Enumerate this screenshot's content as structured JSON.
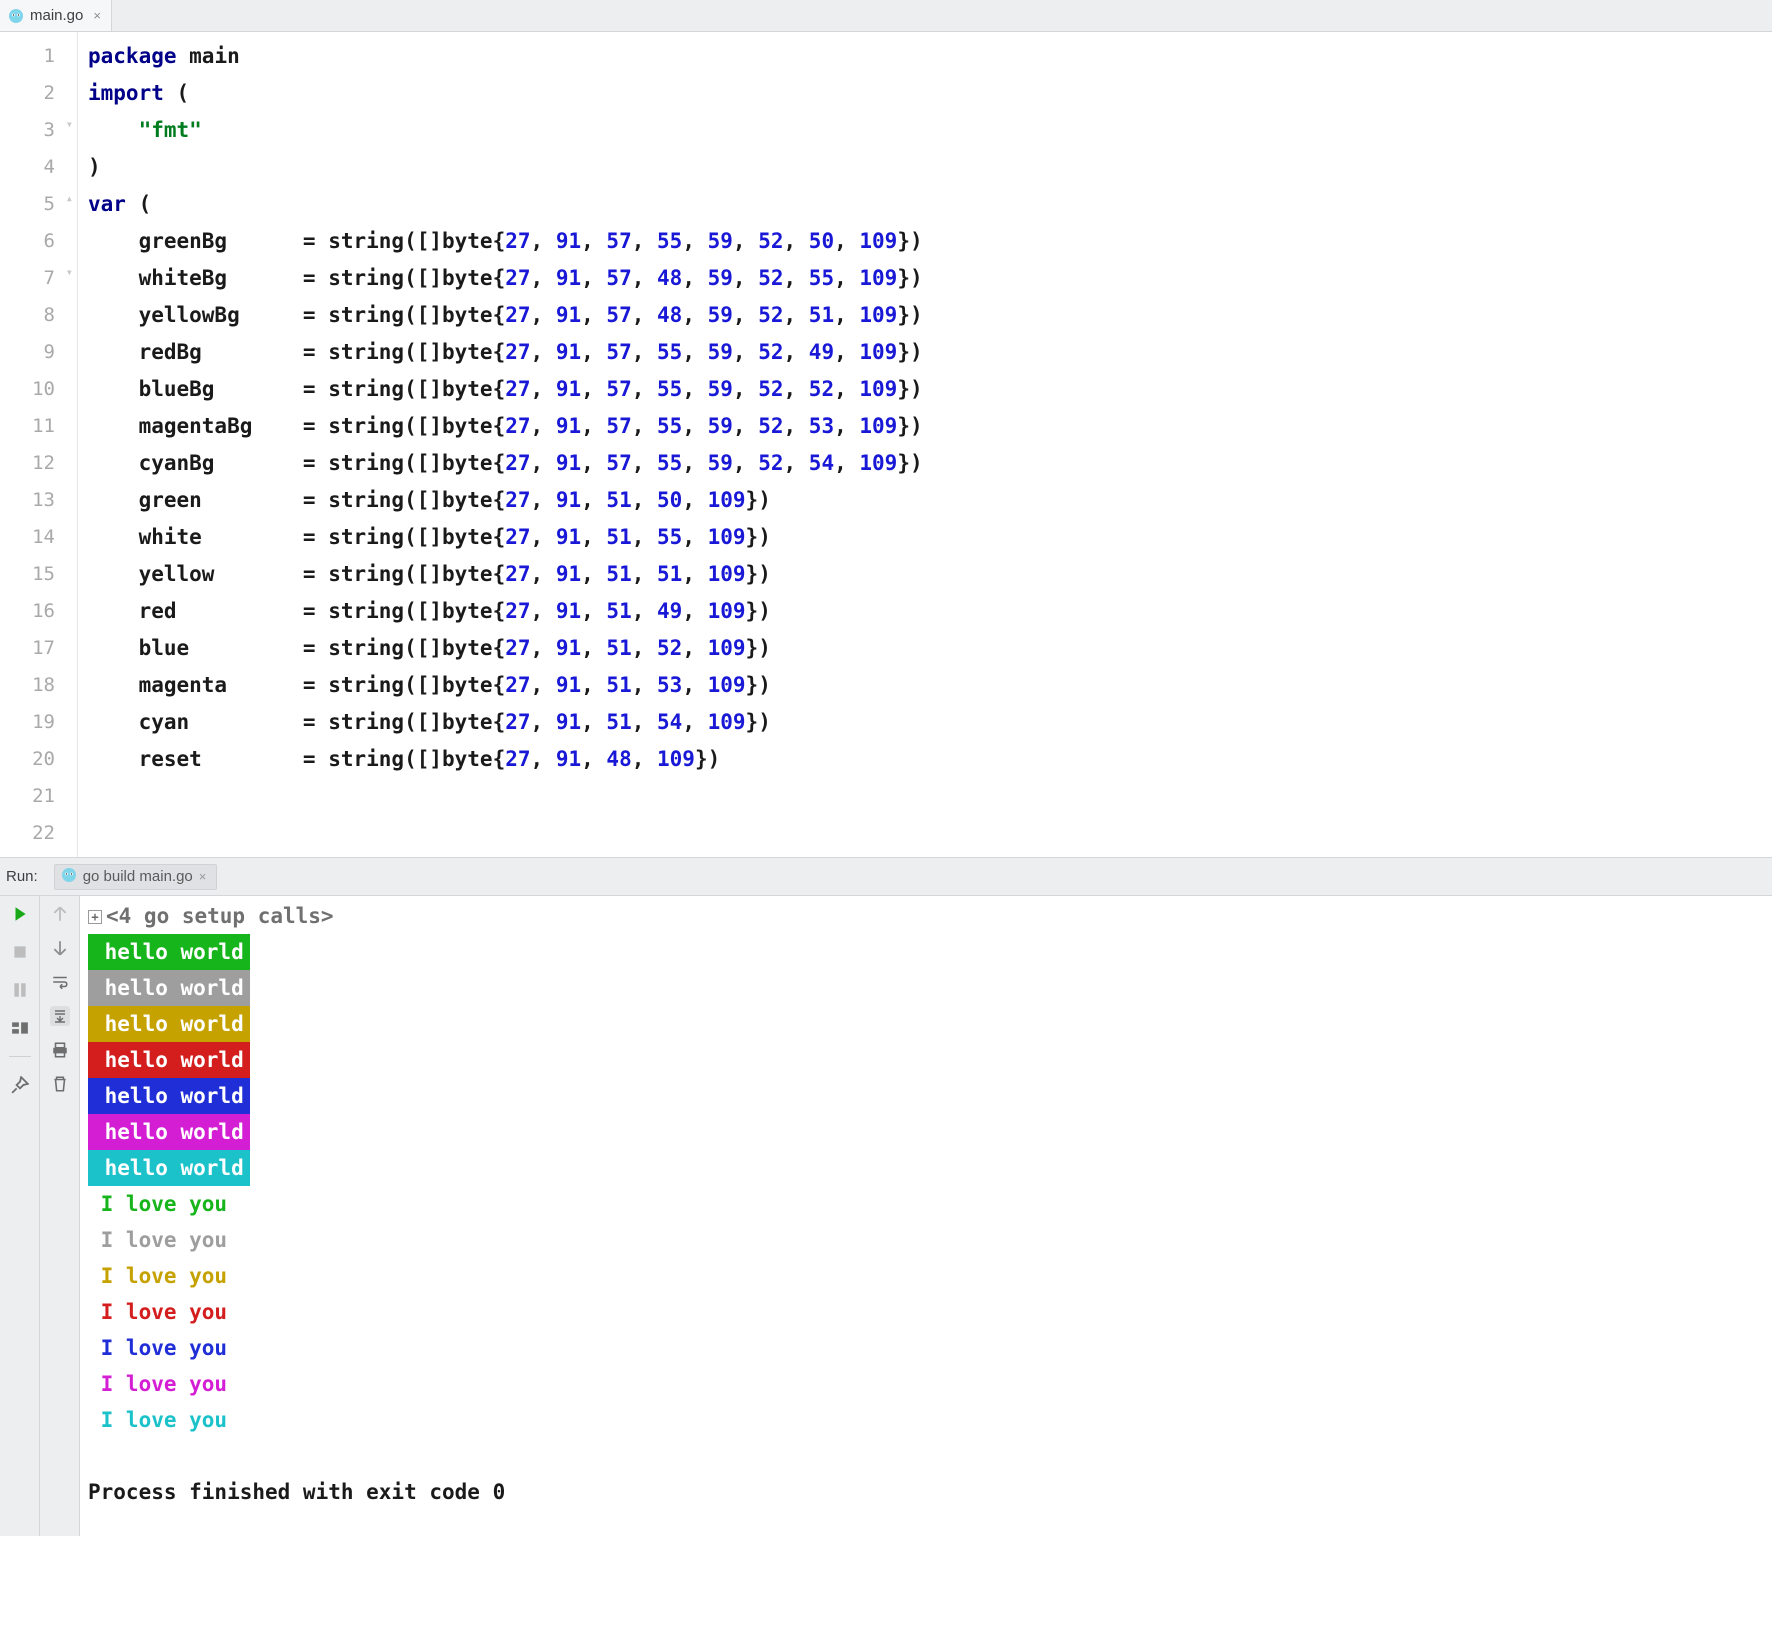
{
  "tab": {
    "filename": "main.go",
    "close_glyph": "×"
  },
  "editor": {
    "line_count": 22,
    "code_pre": "package",
    "code_main": " main",
    "line3_kw": "import",
    "line3_rest": " (",
    "line4_indent": "    ",
    "line4_str": "\"fmt\"",
    "line5": ")",
    "line7_kw": "var",
    "line7_rest": " (",
    "vars": [
      {
        "name": "greenBg",
        "pad": "      ",
        "bytes": [
          27,
          91,
          57,
          55,
          59,
          52,
          50,
          109
        ]
      },
      {
        "name": "whiteBg",
        "pad": "      ",
        "bytes": [
          27,
          91,
          57,
          48,
          59,
          52,
          55,
          109
        ]
      },
      {
        "name": "yellowBg",
        "pad": "     ",
        "bytes": [
          27,
          91,
          57,
          48,
          59,
          52,
          51,
          109
        ]
      },
      {
        "name": "redBg",
        "pad": "        ",
        "bytes": [
          27,
          91,
          57,
          55,
          59,
          52,
          49,
          109
        ]
      },
      {
        "name": "blueBg",
        "pad": "       ",
        "bytes": [
          27,
          91,
          57,
          55,
          59,
          52,
          52,
          109
        ]
      },
      {
        "name": "magentaBg",
        "pad": "    ",
        "bytes": [
          27,
          91,
          57,
          55,
          59,
          52,
          53,
          109
        ]
      },
      {
        "name": "cyanBg",
        "pad": "       ",
        "bytes": [
          27,
          91,
          57,
          55,
          59,
          52,
          54,
          109
        ]
      },
      {
        "name": "green",
        "pad": "        ",
        "bytes": [
          27,
          91,
          51,
          50,
          109
        ]
      },
      {
        "name": "white",
        "pad": "        ",
        "bytes": [
          27,
          91,
          51,
          55,
          109
        ]
      },
      {
        "name": "yellow",
        "pad": "       ",
        "bytes": [
          27,
          91,
          51,
          51,
          109
        ]
      },
      {
        "name": "red",
        "pad": "          ",
        "bytes": [
          27,
          91,
          51,
          49,
          109
        ]
      },
      {
        "name": "blue",
        "pad": "         ",
        "bytes": [
          27,
          91,
          51,
          52,
          109
        ]
      },
      {
        "name": "magenta",
        "pad": "      ",
        "bytes": [
          27,
          91,
          51,
          53,
          109
        ]
      },
      {
        "name": "cyan",
        "pad": "         ",
        "bytes": [
          27,
          91,
          51,
          54,
          109
        ]
      },
      {
        "name": "reset",
        "pad": "        ",
        "bytes": [
          27,
          91,
          48,
          109
        ]
      }
    ]
  },
  "run": {
    "label": "Run:",
    "tab_label": "go build main.go",
    "setup_line": "<4 go setup calls>",
    "bg_lines": [
      {
        "cls": "bg-green",
        "text": " hello world"
      },
      {
        "cls": "bg-white",
        "text": " hello world"
      },
      {
        "cls": "bg-yellow",
        "text": " hello world"
      },
      {
        "cls": "bg-red",
        "text": " hello world"
      },
      {
        "cls": "bg-blue",
        "text": " hello world"
      },
      {
        "cls": "bg-magenta",
        "text": " hello world"
      },
      {
        "cls": "bg-cyan",
        "text": " hello world"
      }
    ],
    "fg_lines": [
      {
        "cls": "fg-green",
        "text": " I love you"
      },
      {
        "cls": "fg-white",
        "text": " I love you"
      },
      {
        "cls": "fg-yellow",
        "text": " I love you"
      },
      {
        "cls": "fg-red",
        "text": " I love you"
      },
      {
        "cls": "fg-blue",
        "text": " I love you"
      },
      {
        "cls": "fg-magenta",
        "text": " I love you"
      },
      {
        "cls": "fg-cyan",
        "text": " I love you"
      }
    ],
    "exit_line": "Process finished with exit code 0"
  }
}
